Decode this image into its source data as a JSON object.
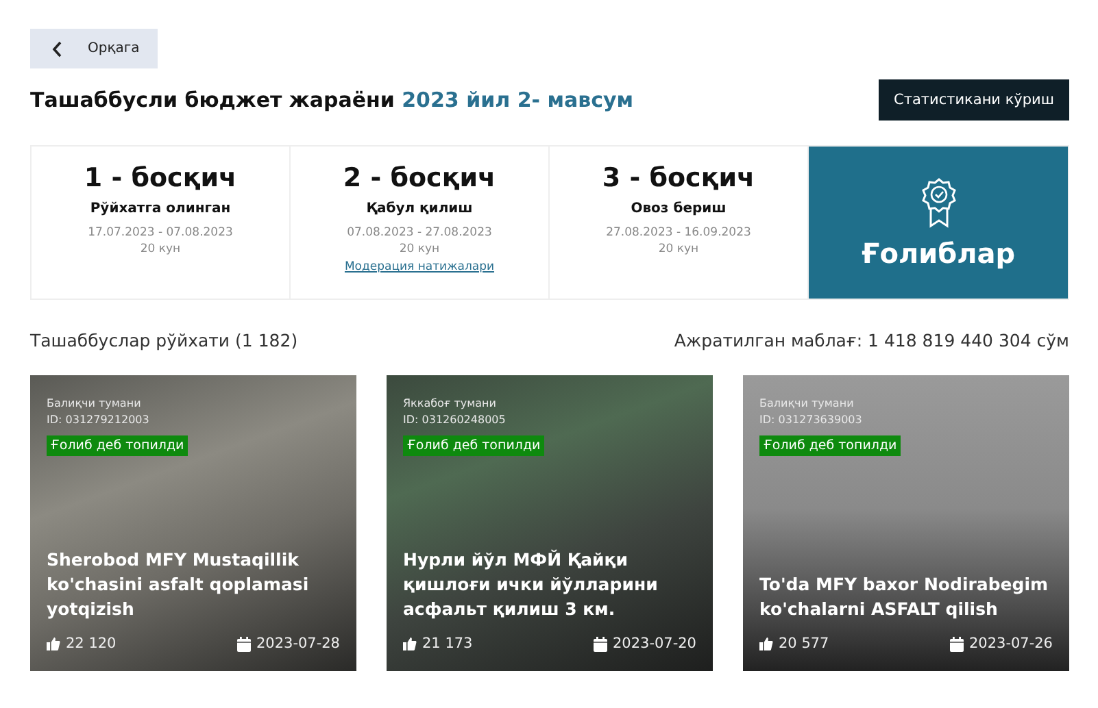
{
  "back_button": {
    "label": "Орқага"
  },
  "header": {
    "title": "Ташаббусли бюджет жараёни",
    "title_highlight": "2023 йил 2- мавсум",
    "stats_button": "Статистикани кўриш"
  },
  "stages": [
    {
      "number": "1 - босқич",
      "name": "Рўйхатга олинган",
      "dates": "17.07.2023 - 07.08.2023",
      "days": "20 кун"
    },
    {
      "number": "2 - босқич",
      "name": "Қабул қилиш",
      "dates": "07.08.2023 - 27.08.2023",
      "days": "20 кун",
      "link": "Модерация натижалари"
    },
    {
      "number": "3 - босқич",
      "name": "Овоз бериш",
      "dates": "27.08.2023 - 16.09.2023",
      "days": "20 кун"
    }
  ],
  "winners_tile": {
    "label": "Ғолиблар"
  },
  "list_header": {
    "count": "Ташаббуслар рўйхати (1 182)",
    "budget": "Ажратилган маблағ: 1 418 819 440 304 сўм"
  },
  "cards": [
    {
      "district": "Балиқчи тумани",
      "id": "ID: 031279212003",
      "badge": "Ғолиб деб топилди",
      "title": "Sherobod MFY Mustaqillik ko'chasini asfalt qoplamasi yotqizish",
      "likes": "22 120",
      "date": "2023-07-28"
    },
    {
      "district": "Яккабоғ тумани",
      "id": "ID: 031260248005",
      "badge": "Ғолиб деб топилди",
      "title": "Нурли йўл МФЙ Қайқи қишлоғи ички йўлларини асфальт қилиш 3 км.",
      "likes": "21 173",
      "date": "2023-07-20"
    },
    {
      "district": "Балиқчи тумани",
      "id": "ID: 031273639003",
      "badge": "Ғолиб деб топилди",
      "title": "To'da MFY baxor Nodirabegim ko'chalarni ASFALT qilish",
      "likes": "20 577",
      "date": "2023-07-26"
    }
  ]
}
